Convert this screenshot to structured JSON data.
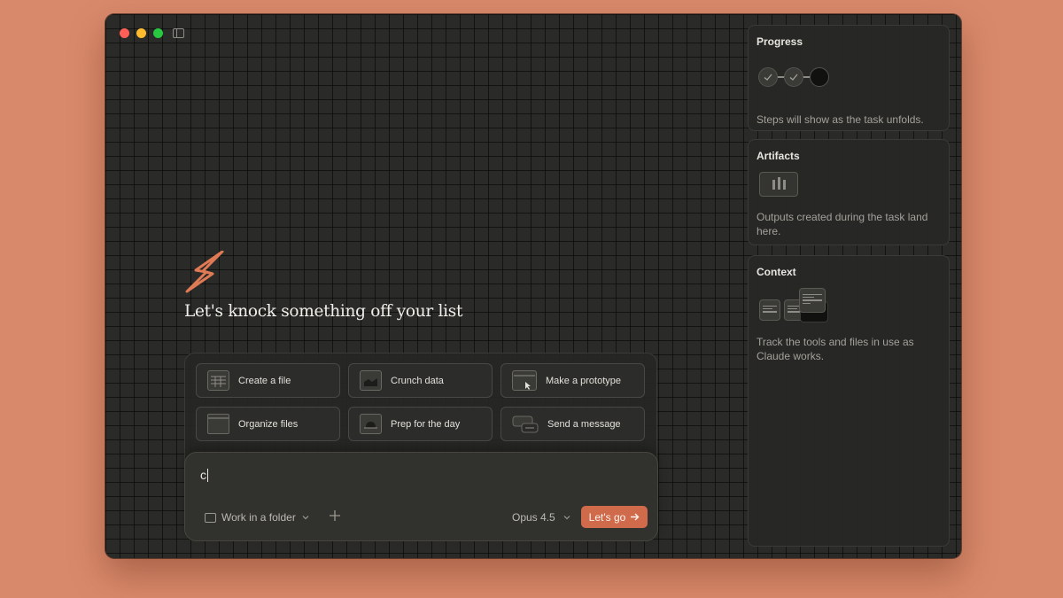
{
  "window": {
    "traffic_lights": [
      "close",
      "minimize",
      "zoom"
    ],
    "sidebar_toggle_icon": "sidebar-icon"
  },
  "main": {
    "logo_icon": "lightning-bolt-logo",
    "headline": "Let's knock something off your list",
    "tiles": [
      {
        "label": "Create a file",
        "icon": "spreadsheet-icon"
      },
      {
        "label": "Crunch data",
        "icon": "chart-icon"
      },
      {
        "label": "Make a prototype",
        "icon": "browser-window-icon"
      },
      {
        "label": "Organize files",
        "icon": "folder-icon"
      },
      {
        "label": "Prep for the day",
        "icon": "calendar-icon"
      },
      {
        "label": "Send a message",
        "icon": "chat-icon"
      }
    ],
    "input": {
      "value": "c",
      "folder_label": "Work in a folder",
      "model_label": "Opus 4.5",
      "submit_label": "Let's go"
    }
  },
  "panels": {
    "progress": {
      "title": "Progress",
      "description": "Steps will show as the task unfolds.",
      "steps": [
        "done",
        "done",
        "current"
      ]
    },
    "artifacts": {
      "title": "Artifacts",
      "description": "Outputs created during the task land here."
    },
    "context": {
      "title": "Context",
      "description": "Track the tools and files in use as Claude works."
    }
  },
  "colors": {
    "background": "#D9896B",
    "window": "#2A2A28",
    "accent": "#CF6A4A"
  }
}
